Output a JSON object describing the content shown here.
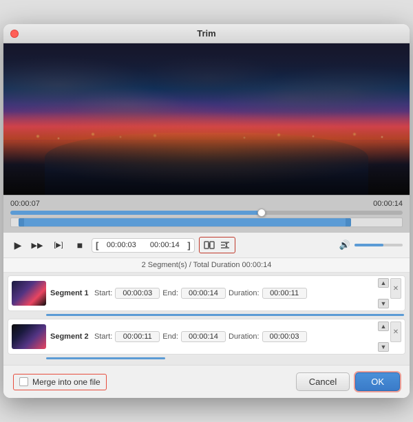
{
  "window": {
    "title": "Trim"
  },
  "timeline": {
    "start_time": "00:00:07",
    "end_time": "00:00:14"
  },
  "controls": {
    "time_range_start": "00:00:03",
    "time_range_end": "00:00:14",
    "play_icon": "▶",
    "fast_forward_icon": "⏩",
    "step_icon": "[▶]",
    "stop_icon": "■",
    "bracket_open": "[",
    "bracket_close": "]"
  },
  "segments_info": {
    "text": "2 Segment(s) / Total Duration 00:00:14"
  },
  "segments": [
    {
      "label": "Segment 1",
      "start_label": "Start:",
      "start_value": "00:00:03",
      "end_label": "End:",
      "end_value": "00:00:14",
      "duration_label": "Duration:",
      "duration_value": "00:00:11",
      "progress_width": "90"
    },
    {
      "label": "Segment 2",
      "start_label": "Start:",
      "start_value": "00:00:11",
      "end_label": "End:",
      "end_value": "00:00:14",
      "duration_label": "Duration:",
      "duration_value": "00:00:03",
      "progress_width": "30"
    }
  ],
  "bottom": {
    "merge_label": "Merge into one file",
    "cancel_label": "Cancel",
    "ok_label": "OK"
  }
}
